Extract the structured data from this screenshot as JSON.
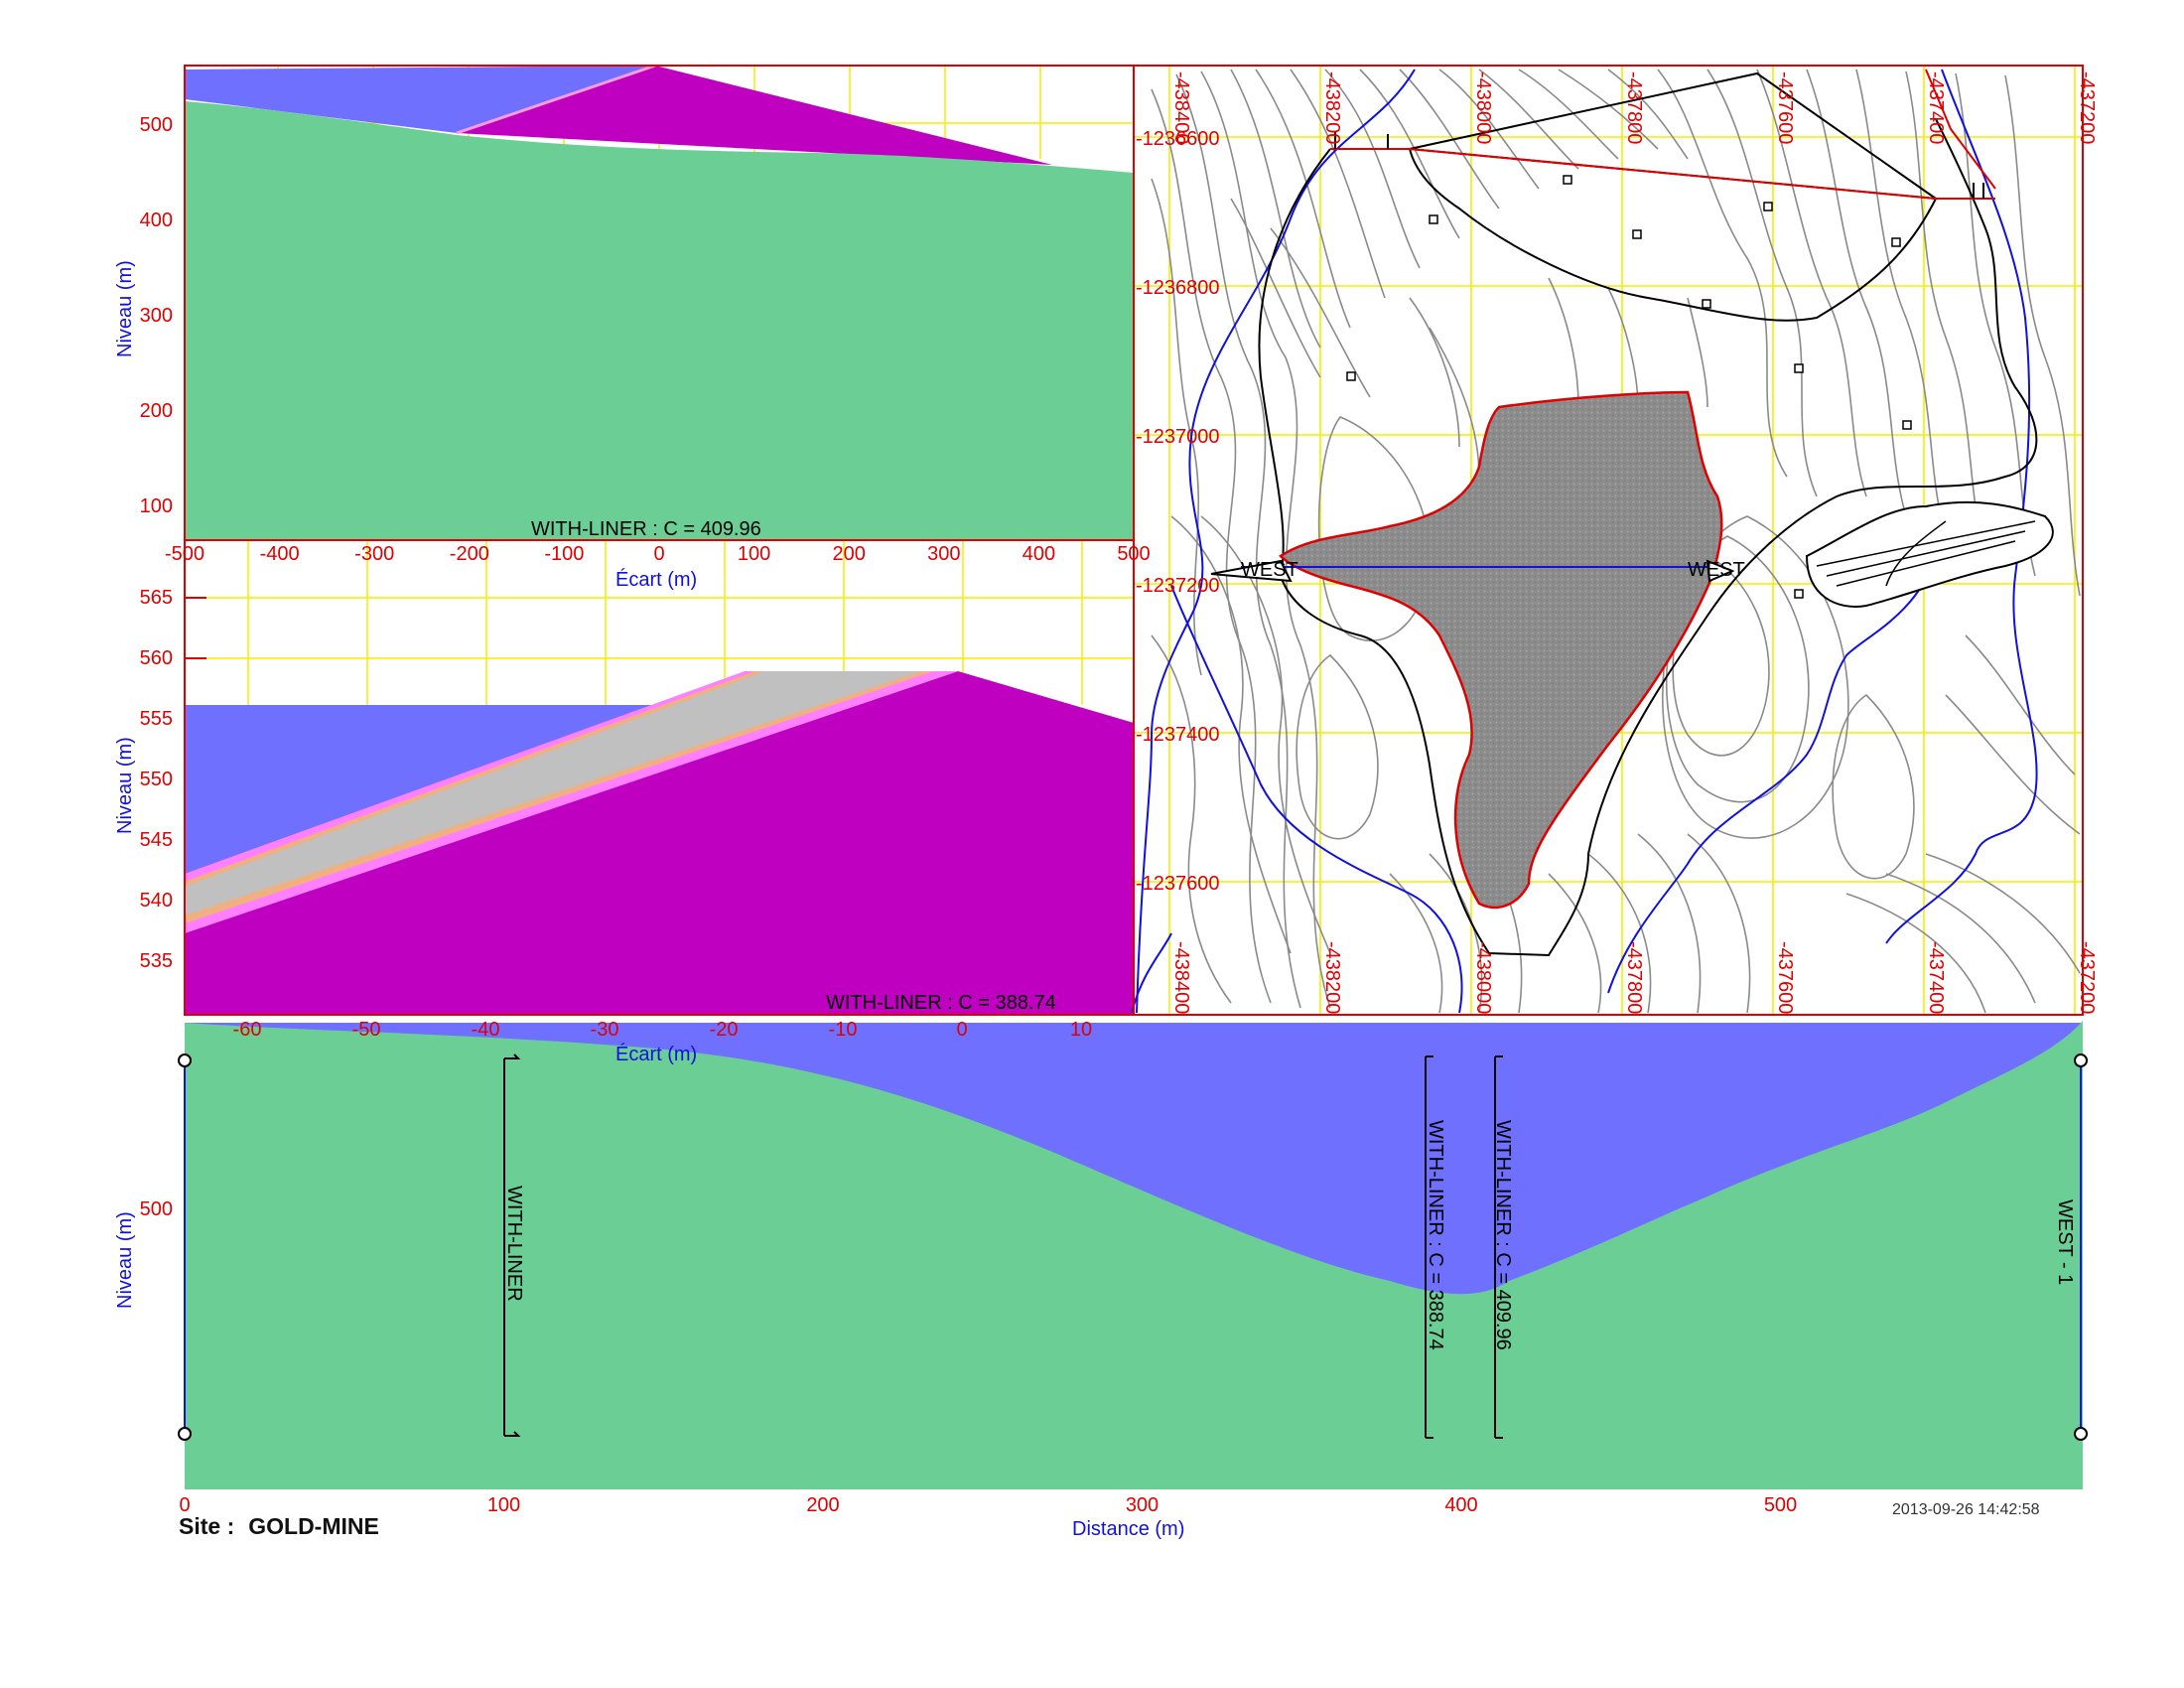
{
  "top_section": {
    "label": "WITH-LINER : C = 409.96",
    "y_axis_title": "Niveau (m)",
    "x_axis_title": "Écart (m)",
    "y_ticks": [
      "500",
      "400",
      "300",
      "200",
      "100"
    ],
    "x_ticks": [
      "-500",
      "-400",
      "-300",
      "-200",
      "-100",
      "0",
      "100",
      "200",
      "300",
      "400",
      "500"
    ],
    "colors": {
      "fill": "#6bcf95",
      "cover": "#7070ff",
      "waste": "#c000c0"
    }
  },
  "middle_section": {
    "label": "WITH-LINER : C = 388.74",
    "y_axis_title": "Niveau (m)",
    "x_axis_title": "Écart (m)",
    "y_ticks": [
      "565",
      "560",
      "555",
      "550",
      "545",
      "540",
      "535"
    ],
    "x_ticks": [
      "-60",
      "-50",
      "-40",
      "-30",
      "-20",
      "-10",
      "0",
      "10"
    ],
    "colors": {
      "liner": "#c0c0c0",
      "liner_edge": "#ff80ff",
      "liner_sand": "#f0b080"
    }
  },
  "plan_view": {
    "northing_labels": [
      "-1236600",
      "-1236800",
      "-1237000",
      "-1237200",
      "-1237400",
      "-1237600"
    ],
    "easting_labels_top": [
      "-438400",
      "-438200",
      "-438000",
      "-437800",
      "-437600",
      "-437400",
      "-437200"
    ],
    "easting_labels_bottom": [
      "-438400",
      "-438200",
      "-438000",
      "-437800",
      "-437600",
      "-437400",
      "-437200"
    ],
    "section_labels": [
      "WEST",
      "WEST"
    ],
    "colors": {
      "grid": "#f0f000",
      "contour": "#808080",
      "stream": "#1010e0",
      "pit": "#909090",
      "boundary": "#e00000"
    }
  },
  "profile": {
    "y_axis_title": "Niveau (m)",
    "x_axis_title": "Distance (m)",
    "y_ticks": [
      "500"
    ],
    "x_ticks": [
      "0",
      "100",
      "200",
      "300",
      "400",
      "500"
    ],
    "markers": [
      "WITH-LINER",
      "WITH-LINER : C = 388.74",
      "WITH-LINER : C = 409.96"
    ],
    "end_label": "WEST - 1"
  },
  "footer": {
    "site_label": "Site :",
    "site_name": "GOLD-MINE",
    "timestamp": "2013-09-26 14:42:58"
  }
}
